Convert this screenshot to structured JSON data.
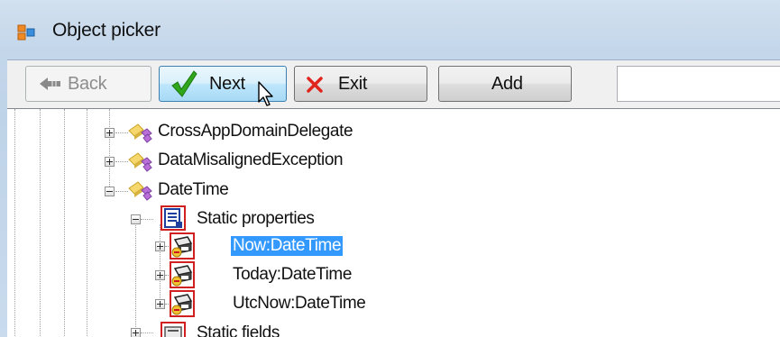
{
  "window": {
    "title": "Object picker"
  },
  "toolbar": {
    "back_label": "Back",
    "next_label": "Next",
    "exit_label": "Exit",
    "add_label": "Add",
    "search_value": ""
  },
  "tree": {
    "nodes": [
      {
        "label": "CrossAppDomainDelegate",
        "level": 2,
        "expander": "plus",
        "icon": "class-icon"
      },
      {
        "label": "DataMisalignedException",
        "level": 2,
        "expander": "plus",
        "icon": "class-icon"
      },
      {
        "label": "DateTime",
        "level": 2,
        "expander": "minus",
        "icon": "class-icon"
      },
      {
        "label": "Static properties",
        "level": 3,
        "expander": "minus",
        "icon": "static-properties-icon"
      },
      {
        "label": "Now:DateTime",
        "level": 4,
        "expander": "plus",
        "icon": "property-icon",
        "selected": true
      },
      {
        "label": "Today:DateTime",
        "level": 4,
        "expander": "plus",
        "icon": "property-icon"
      },
      {
        "label": "UtcNow:DateTime",
        "level": 4,
        "expander": "plus",
        "icon": "property-icon"
      },
      {
        "label": "Static fields",
        "level": 3,
        "expander": "plus",
        "icon": "static-fields-icon"
      }
    ]
  },
  "colors": {
    "selection": "#3399ff",
    "window_frame": "#c3d6ea",
    "exit_x": "#e0251c",
    "next_check": "#2fa61b"
  }
}
